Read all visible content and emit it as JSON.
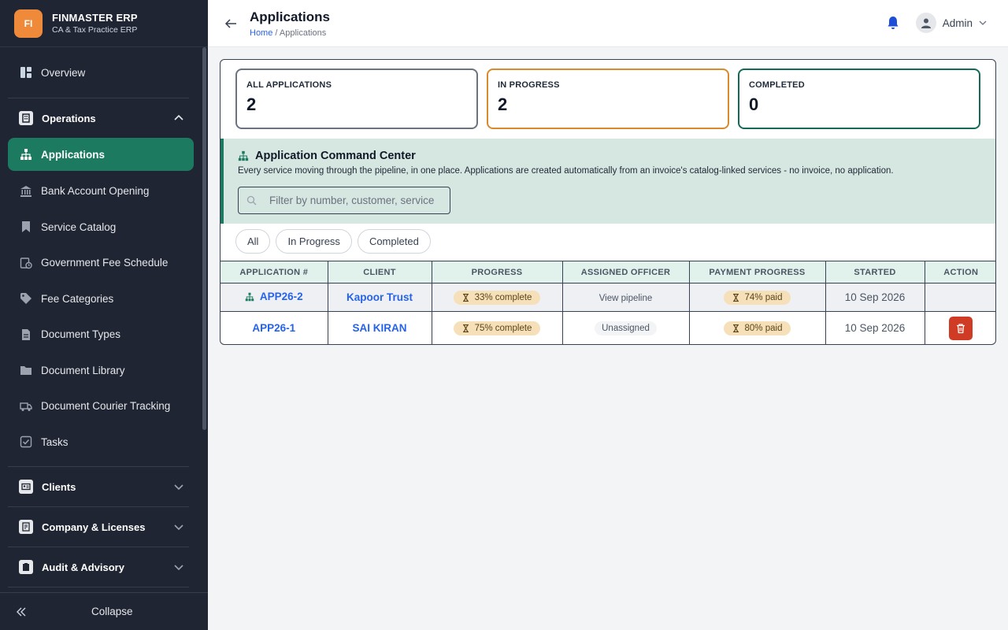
{
  "brand": {
    "logo_text": "FI",
    "name": "FINMASTER ERP",
    "subtitle": "CA & Tax Practice ERP"
  },
  "sidebar": {
    "overview": "Overview",
    "operations": {
      "label": "Operations",
      "items": [
        {
          "label": "Applications",
          "icon": "sitemap-icon",
          "active": true
        },
        {
          "label": "Bank Account Opening",
          "icon": "bank-icon"
        },
        {
          "label": "Service Catalog",
          "icon": "bookmark-icon"
        },
        {
          "label": "Government Fee Schedule",
          "icon": "fee-schedule-icon"
        },
        {
          "label": "Fee Categories",
          "icon": "tag-icon"
        },
        {
          "label": "Document Types",
          "icon": "document-icon"
        },
        {
          "label": "Document Library",
          "icon": "folder-icon"
        },
        {
          "label": "Document Courier Tracking",
          "icon": "truck-icon"
        },
        {
          "label": "Tasks",
          "icon": "checkbox-icon"
        }
      ]
    },
    "groups": [
      {
        "label": "Clients",
        "icon": "id-card-icon"
      },
      {
        "label": "Company & Licenses",
        "icon": "license-icon"
      },
      {
        "label": "Audit & Advisory",
        "icon": "clipboard-icon"
      }
    ],
    "collapse_label": "Collapse"
  },
  "header": {
    "title": "Applications",
    "breadcrumb_home": "Home",
    "breadcrumb_sep": " / ",
    "breadcrumb_current": "Applications",
    "user_name": "Admin"
  },
  "stats": [
    {
      "label": "ALL APPLICATIONS",
      "value": "2"
    },
    {
      "label": "IN PROGRESS",
      "value": "2"
    },
    {
      "label": "COMPLETED",
      "value": "0"
    }
  ],
  "command_center": {
    "title": "Application Command Center",
    "description": "Every service moving through the pipeline, in one place. Applications are created automatically from an invoice's catalog-linked services - no invoice, no application.",
    "search_placeholder": "Filter by number, customer, service"
  },
  "filters": [
    "All",
    "In Progress",
    "Completed"
  ],
  "table": {
    "columns": [
      "APPLICATION #",
      "CLIENT",
      "PROGRESS",
      "ASSIGNED OFFICER",
      "PAYMENT PROGRESS",
      "STARTED",
      "ACTION"
    ],
    "rows": [
      {
        "app": "APP26-2",
        "client": "Kapoor Trust",
        "progress": "33% complete",
        "officer": "View pipeline",
        "payment": "74% paid",
        "started": "10 Sep 2026"
      },
      {
        "app": "APP26-1",
        "client": "SAI KIRAN",
        "progress": "75% complete",
        "officer": "Unassigned",
        "payment": "80% paid",
        "started": "10 Sep 2026"
      }
    ]
  },
  "colors": {
    "sidebar_bg": "#1f2532",
    "accent_green": "#1b7a5f",
    "brand_orange": "#ef8a3a",
    "danger": "#cf3b25",
    "link_blue": "#2563eb"
  }
}
